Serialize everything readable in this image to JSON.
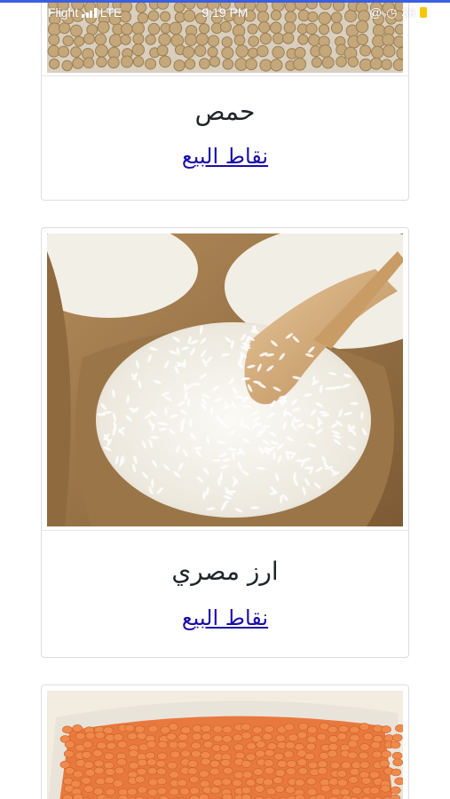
{
  "colors": {
    "progress_bar": "#3b5fe0",
    "link": "#1a0dab",
    "title": "#212529",
    "card_border": "#dadde1",
    "battery": "#f5c800"
  },
  "status_bar": {
    "carrier": "Flight",
    "network": "LTE",
    "time": "9:19 PM",
    "battery_percent": "33",
    "icons": [
      "signal-bars-icon",
      "at-sign-icon",
      "alarm-icon",
      "battery-icon"
    ]
  },
  "products": [
    {
      "name": "حمص",
      "link_label": "نقاط البيع",
      "image": "chickpeas-image"
    },
    {
      "name": "ارز مصري",
      "link_label": "نقاط البيع",
      "image": "egyptian-rice-image"
    },
    {
      "name": "",
      "link_label": "",
      "image": "red-lentils-image"
    }
  ]
}
